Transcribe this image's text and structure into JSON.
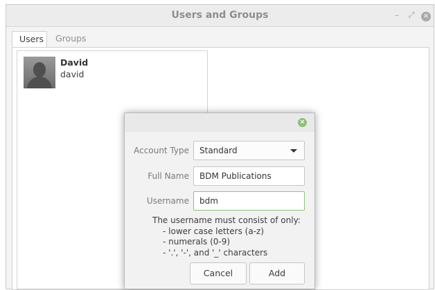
{
  "window": {
    "title": "Users and Groups",
    "minimize_glyph": "–",
    "maximize_glyph": "⤢",
    "close_glyph": "×"
  },
  "tabs": [
    {
      "label": "Users",
      "active": true
    },
    {
      "label": "Groups",
      "active": false
    }
  ],
  "users": [
    {
      "display_name": "David",
      "login": "david",
      "icon": "person-avatar-icon"
    }
  ],
  "dialog": {
    "close_glyph": "×",
    "fields": {
      "account_type": {
        "label": "Account Type",
        "value": "Standard"
      },
      "full_name": {
        "label": "Full Name",
        "value": "BDM Publications"
      },
      "username": {
        "label": "Username",
        "value": "bdm"
      }
    },
    "help": {
      "intro": "The username must consist of only:",
      "rules": [
        "- lower case letters (a-z)",
        "- numerals (0-9)",
        "- '.', '-', and '_' characters"
      ]
    },
    "buttons": {
      "cancel": "Cancel",
      "add": "Add"
    }
  },
  "colors": {
    "accent_green": "#8cc277",
    "window_bg": "#f4f4f4",
    "title_text": "#8e8e8e"
  }
}
